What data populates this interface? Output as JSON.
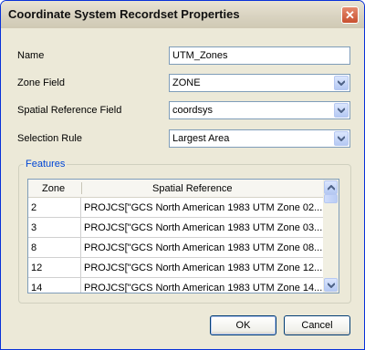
{
  "window": {
    "title": "Coordinate System Recordset Properties"
  },
  "form": {
    "name_label": "Name",
    "name_value": "UTM_Zones",
    "zone_field_label": "Zone Field",
    "zone_field_value": "ZONE",
    "spatial_ref_label": "Spatial Reference Field",
    "spatial_ref_value": "coordsys",
    "selection_rule_label": "Selection Rule",
    "selection_rule_value": "Largest Area"
  },
  "features": {
    "title": "Features",
    "columns": [
      "Zone",
      "Spatial Reference"
    ],
    "rows": [
      {
        "zone": "2",
        "sr": "PROJCS[\"GCS North American 1983 UTM Zone 02..."
      },
      {
        "zone": "3",
        "sr": "PROJCS[\"GCS North American 1983 UTM Zone 03..."
      },
      {
        "zone": "8",
        "sr": "PROJCS[\"GCS North American 1983 UTM Zone 08..."
      },
      {
        "zone": "12",
        "sr": "PROJCS[\"GCS North American 1983 UTM Zone 12..."
      },
      {
        "zone": "14",
        "sr": "PROJCS[\"GCS North American 1983 UTM Zone 14..."
      }
    ]
  },
  "buttons": {
    "ok": "OK",
    "cancel": "Cancel"
  },
  "icons": {
    "close": "close-icon",
    "dropdown": "chevron-down-icon",
    "scroll_up": "chevron-up-icon",
    "scroll_down": "chevron-down-icon"
  },
  "colors": {
    "accent": "#0046d5",
    "window_bg": "#ece9d8",
    "border": "#7f9db9"
  }
}
